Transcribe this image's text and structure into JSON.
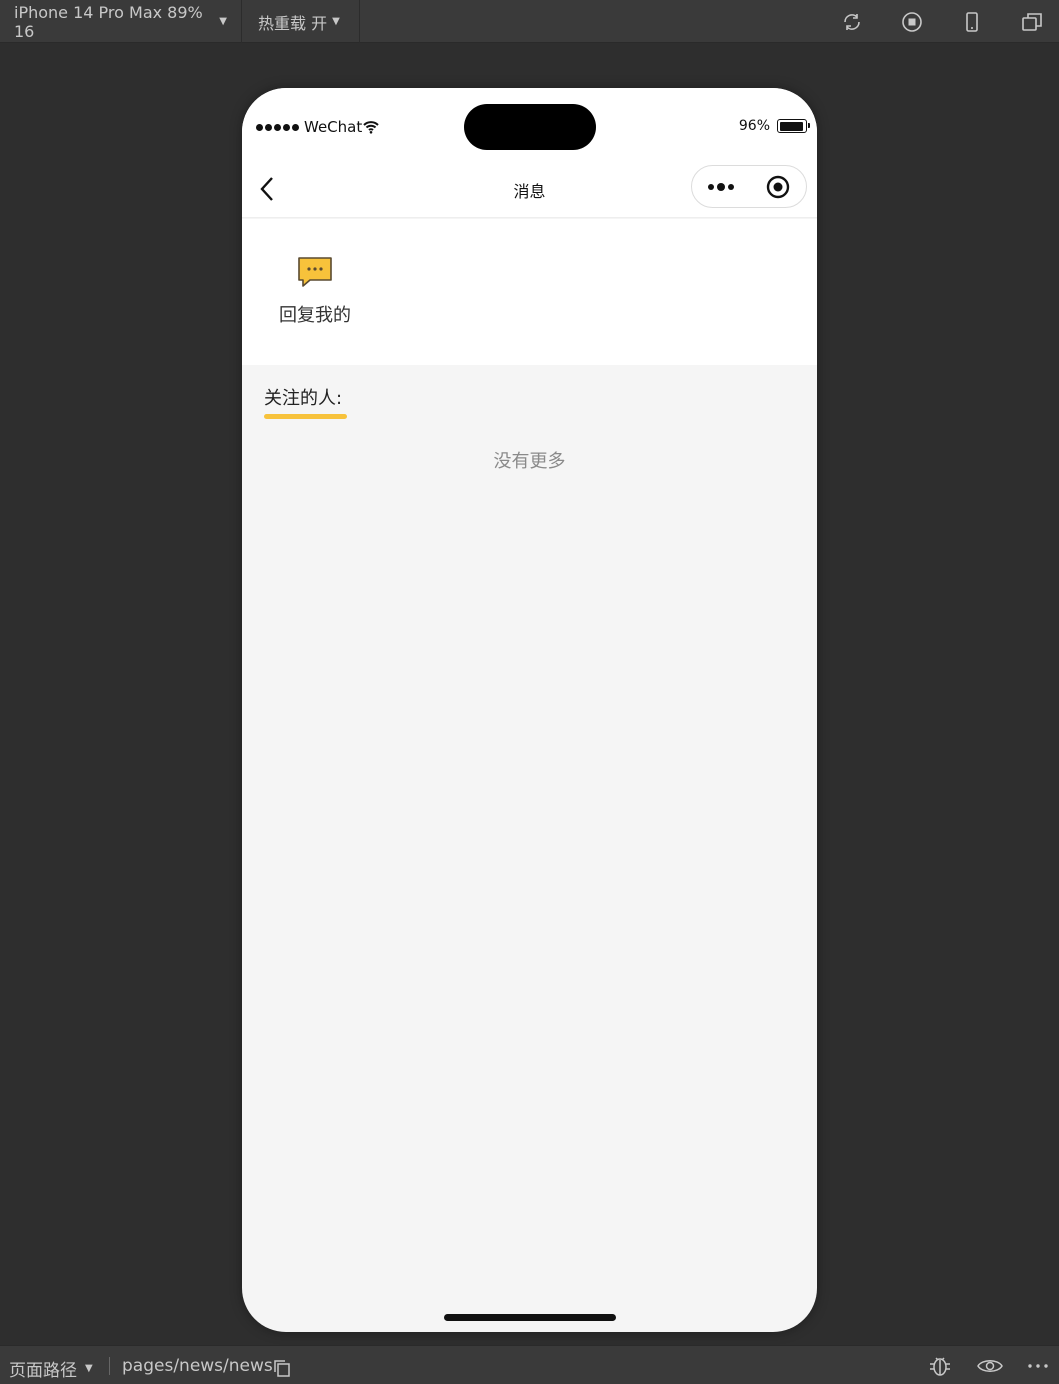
{
  "toolbar": {
    "device": "iPhone 14 Pro Max 89% 16",
    "hot_reload": "热重载 开",
    "icons": [
      "refresh-icon",
      "stop-icon",
      "phone-icon",
      "window-icon"
    ]
  },
  "status_bar": {
    "carrier": "WeChat",
    "battery": "96%"
  },
  "nav": {
    "title": "消息"
  },
  "menu": {
    "items": [
      {
        "label": "回复我的",
        "icon": "message-bubble-icon"
      }
    ]
  },
  "follow": {
    "title": "关注的人:",
    "empty_text": "没有更多"
  },
  "bottom_bar": {
    "path_label": "页面路径",
    "path": "pages/news/news"
  },
  "colors": {
    "accent": "#f7c23b",
    "background": "#f5f5f5",
    "chrome": "#3a3a3a"
  }
}
